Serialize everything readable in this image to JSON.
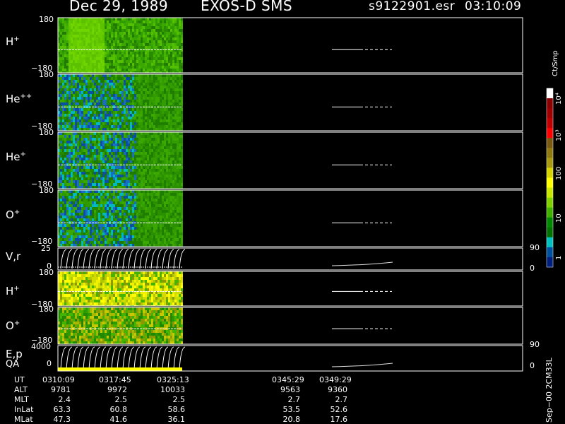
{
  "header": {
    "date": "Dec 29, 1989",
    "title": "EXOS-D SMS",
    "file": "s9122901.esr",
    "time": "03:10:09"
  },
  "panels": [
    {
      "id": "h1",
      "label": "H",
      "sup": "+",
      "ymax": "180",
      "ymin": "−180",
      "kind": "spectro",
      "palette": "green"
    },
    {
      "id": "hepp",
      "label": "He",
      "sup": "++",
      "ymax": "180",
      "ymin": "−180",
      "kind": "spectro",
      "palette": "blue-green"
    },
    {
      "id": "hep",
      "label": "He",
      "sup": "+",
      "ymax": "180",
      "ymin": "−180",
      "kind": "spectro",
      "palette": "blue-green"
    },
    {
      "id": "o1",
      "label": "O",
      "sup": "+",
      "ymax": "180",
      "ymin": "−180",
      "kind": "spectro",
      "palette": "blue-green"
    },
    {
      "id": "vr",
      "label": "V,r",
      "sup": "",
      "ymax": "25",
      "ymin": "0",
      "right_top": "90",
      "right_bottom": "0",
      "kind": "lines"
    },
    {
      "id": "h2",
      "label": "H",
      "sup": "+",
      "ymax": "180",
      "ymin": "−180",
      "kind": "spectro",
      "palette": "yellow"
    },
    {
      "id": "o2",
      "label": "O",
      "sup": "+",
      "ymax": "180",
      "ymin": "−180",
      "kind": "spectro",
      "palette": "yellow-green"
    },
    {
      "id": "ep",
      "label": "E,p",
      "label2": "QA",
      "sup": "",
      "ymax": "4000",
      "ymin": "0",
      "right_top": "90",
      "right_bottom": "0",
      "kind": "lines"
    }
  ],
  "colorbar": {
    "unit": "Ct/Smp",
    "tick_labels": [
      "10⁴",
      "10³",
      "100",
      "10",
      "1"
    ],
    "colors": [
      "#ffffff",
      "#8b0000",
      "#a00000",
      "#c00000",
      "#ff0000",
      "#7a5a10",
      "#8f7a10",
      "#a69a10",
      "#d4d400",
      "#ffff00",
      "#c8e600",
      "#80d000",
      "#40b000",
      "#008800",
      "#007000",
      "#00c0c0",
      "#0050a0",
      "#002080"
    ]
  },
  "time_axis": {
    "rows": [
      {
        "name": "UT",
        "values": [
          "0310:09",
          "0317:45",
          "0325:13",
          "0345:29",
          "0349:29"
        ]
      },
      {
        "name": "ALT",
        "values": [
          "9781",
          "9972",
          "10033",
          "9563",
          "9360"
        ]
      },
      {
        "name": "MLT",
        "values": [
          "2.4",
          "2.5",
          "2.5",
          "2.7",
          "2.7"
        ]
      },
      {
        "name": "InLat",
        "values": [
          "63.3",
          "60.8",
          "58.6",
          "53.5",
          "52.6"
        ]
      },
      {
        "name": "MLat",
        "values": [
          "47.3",
          "41.6",
          "36.1",
          "20.8",
          "17.6"
        ]
      }
    ]
  },
  "footer_label": "Sep−00 2CM33L"
}
